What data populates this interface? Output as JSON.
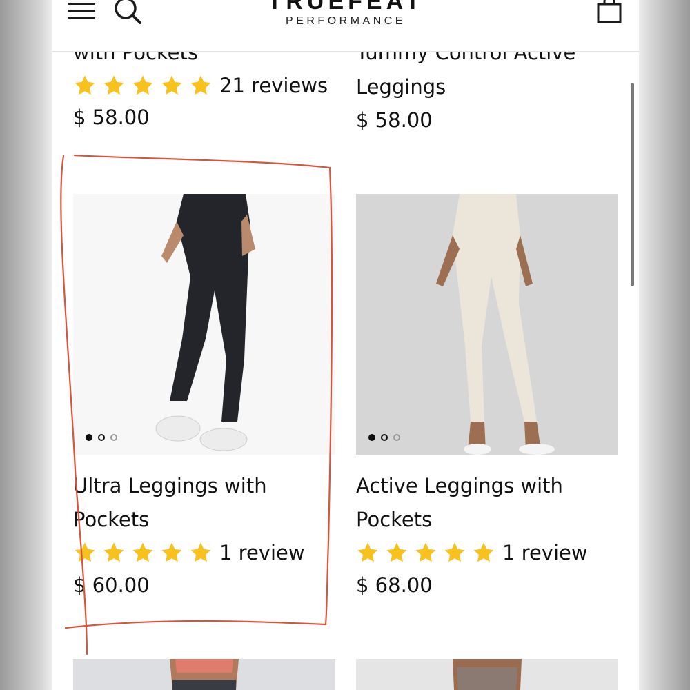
{
  "header": {
    "logo_main": "TRUEFEAT",
    "logo_sub": "PERFORMANCE",
    "menu_icon": "hamburger-menu-icon",
    "search_icon": "search-icon",
    "cart_icon": "shopping-bag-icon"
  },
  "products": [
    {
      "title_visible": "with Pockets",
      "rating_stars": 5,
      "reviews": "21 reviews",
      "price": "$ 58.00"
    },
    {
      "title_line1": "Tummy Control Active",
      "title_line2": "Leggings",
      "price": "$ 58.00"
    },
    {
      "title": "Ultra Leggings with Pockets",
      "rating_stars": 5,
      "reviews": "1 review",
      "price": "$ 60.00",
      "image_carousel": {
        "count": 3,
        "active": 1
      },
      "image_icon": "black-leggings-photo"
    },
    {
      "title": "Active Leggings with Pockets",
      "rating_stars": 5,
      "reviews": "1 review",
      "price": "$ 68.00",
      "image_carousel": {
        "count": 3,
        "active": 1
      },
      "image_icon": "cream-leggings-photo"
    }
  ],
  "colors": {
    "star": "#F7C11E",
    "annotation": "#D9533A",
    "placeholder_bg": "#D6D6D6"
  }
}
